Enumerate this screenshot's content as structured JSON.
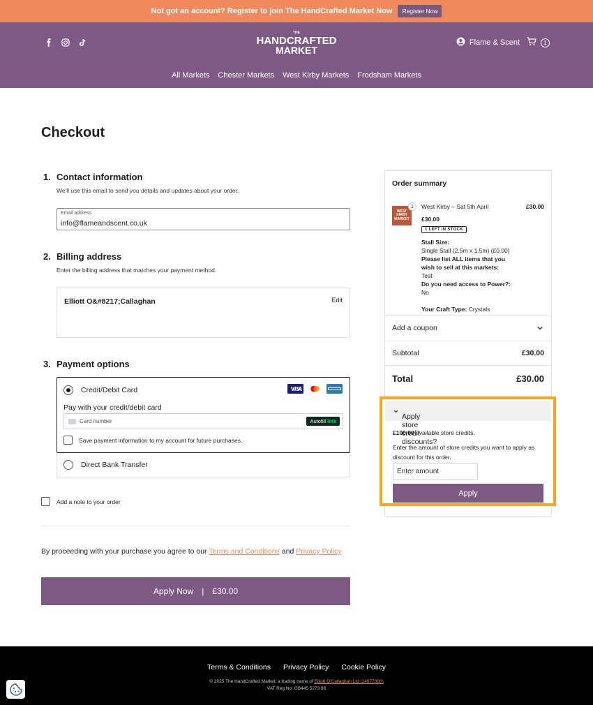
{
  "promo": {
    "text": "Not got an account? Register to join The HandCrafted Market Now",
    "button": "Register Now"
  },
  "header": {
    "logo_top": "THE",
    "logo_main": "HANDCRAFTED",
    "logo_sub": "MARKET",
    "account_name": "Flame & Scent",
    "cart_count": "1",
    "nav": [
      "All Markets",
      "Chester Markets",
      "West Kirby Markets",
      "Frodsham Markets"
    ]
  },
  "checkout": {
    "title": "Checkout",
    "contact": {
      "num": "1.",
      "title": "Contact information",
      "desc": "We'll use this email to send you details and updates about your order.",
      "email_label": "Email address",
      "email_value": "info@flameandscent.co.uk"
    },
    "billing": {
      "num": "2.",
      "title": "Billing address",
      "desc": "Enter the billing address that matches your payment method.",
      "name": "Elliott O&#8217;Callaghan",
      "edit": "Edit"
    },
    "payment": {
      "num": "3.",
      "title": "Payment options",
      "card_label": "Credit/Debit Card",
      "pay_with": "Pay with your credit/debit card",
      "card_placeholder": "Card number",
      "autofill": "Autofill",
      "autofill_link": "link",
      "save_label": "Save payment information to my account for future purchases.",
      "bank_label": "Direct Bank Transfer"
    },
    "note_label": "Add a note to your order",
    "terms_prefix": "By proceeding with your purchase you agree to our",
    "terms_link": "Terms and Conditions",
    "terms_and": "and",
    "privacy_link": "Privacy Policy",
    "apply_now": "Apply Now",
    "apply_sep": "|",
    "apply_amount": "£30.00"
  },
  "summary": {
    "title": "Order summary",
    "thumb_text": "WEST KIRBY MARKET",
    "qty": "1",
    "item_name": "West Kirby – Sat 5th April",
    "item_price_right": "£30.00",
    "item_price": "£30.00",
    "stock": "1 LEFT IN STOCK",
    "stall_size_label": "Stall Size:",
    "stall_size_value": "Single Stall (2.5m x 1.5m) (£0.00)",
    "items_label": "Please list ALL items that you wish to sell at this markets:",
    "items_value": "Test",
    "power_label": "Do you need access to Power?:",
    "power_value": "No",
    "craft_label": "Your Craft Type:",
    "craft_value": "Crystals",
    "coupon": "Add a coupon",
    "subtotal_label": "Subtotal",
    "subtotal_value": "£30.00",
    "total_label": "Total",
    "total_value": "£30.00"
  },
  "credit": {
    "heading": "Apply store credit discounts?",
    "available_amount": "£100.00",
    "available_text": "available store credits.",
    "desc": "Enter the amount of store credits you want to apply as discount for this order.",
    "placeholder": "Enter amount",
    "apply": "Apply"
  },
  "footer": {
    "links": [
      "Terms & Conditions",
      "Privacy Policy",
      "Cookie Policy"
    ],
    "copy_prefix": "© 2025 The HandCrafted Market, a trading name of",
    "copy_link": "Elliott O'Callaghan Ltd (14677390)",
    "vat": "VAT Reg No: GB445 5273 86"
  },
  "colors": {
    "promo": "#f08a5d",
    "brand": "#7d5a83",
    "highlight": "#f5a623",
    "link": "#f08a5d"
  },
  "icons": [
    "facebook-icon",
    "instagram-icon",
    "tiktok-icon",
    "user-icon",
    "cart-icon",
    "chevron-down-icon",
    "cookie-icon"
  ]
}
